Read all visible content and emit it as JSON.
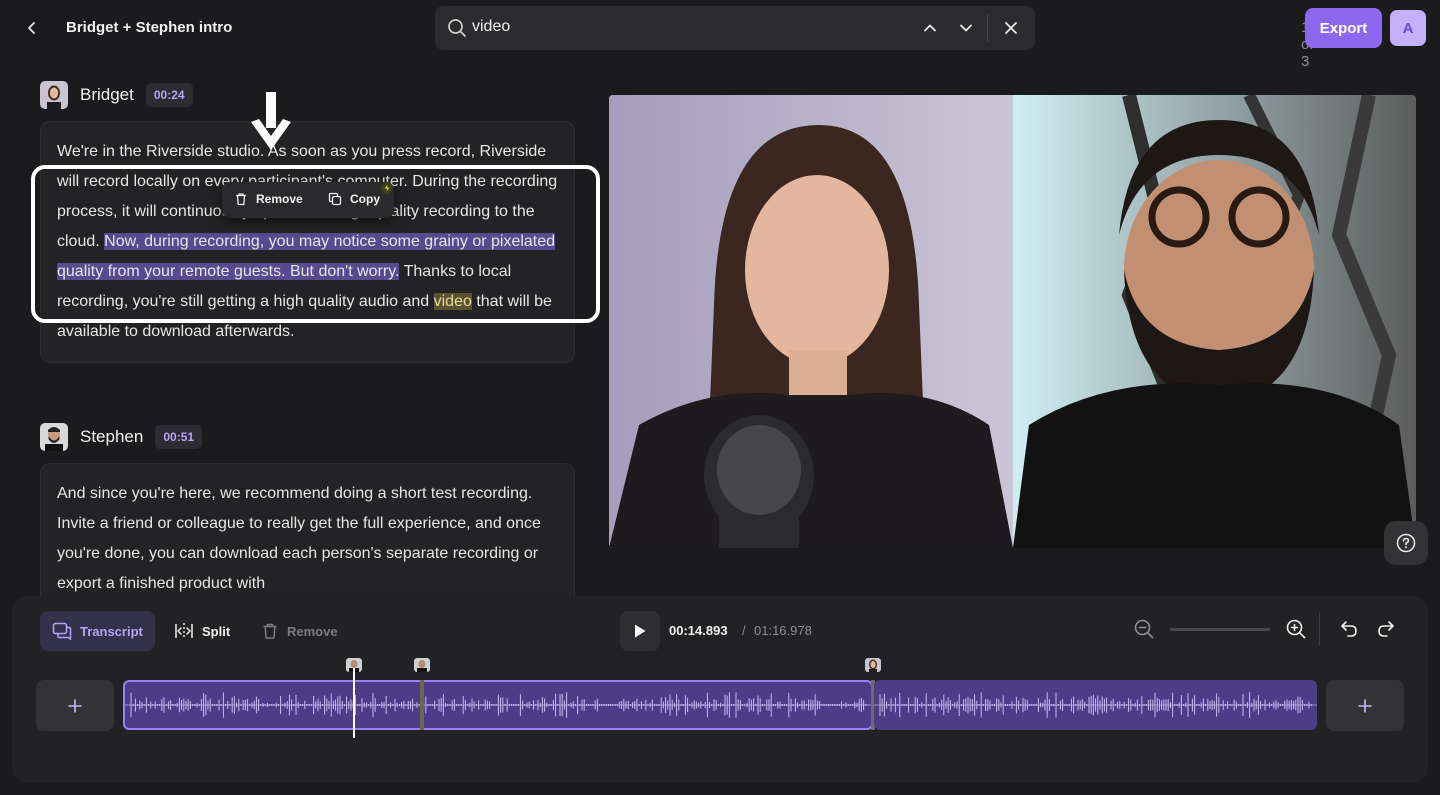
{
  "header": {
    "title": "Bridget + Stephen intro",
    "search_value": "video",
    "search_count": "1 of 3",
    "export_label": "Export",
    "avatar_initial": "A"
  },
  "transcript": [
    {
      "speaker": "Bridget",
      "time": "00:24",
      "segments": {
        "s1": "We're in the Riverside studio. As soon as you press record, Riverside will record locally on every participant's computer. During the recording process, it will continuously upload that high quality recording to the cloud. ",
        "s2": "Now, during recording, you may notice some grainy or pixelated quality from your remote guests. But don't worry.",
        "s3": " Thanks to local recording, you're still getting a high quality audio and ",
        "s4": "video",
        "s5": " that will be available to download afterwards."
      }
    },
    {
      "speaker": "Stephen",
      "time": "00:51",
      "text": "And since you're here, we recommend doing a short test recording. Invite a friend or colleague to really get the full experience, and once you're done, you can download each person's separate recording or export a finished product with"
    }
  ],
  "context_menu": {
    "remove_label": "Remove",
    "copy_label": "Copy"
  },
  "toolbar": {
    "transcript_label": "Transcript",
    "split_label": "Split",
    "remove_label": "Remove",
    "current_time": "00:14.893",
    "separator": "/",
    "total_time": "01:16.978"
  },
  "colors": {
    "accent": "#8c67ef",
    "highlight": "#574a8e",
    "search_match": "#5b5230",
    "clip": "#4c3d88"
  }
}
